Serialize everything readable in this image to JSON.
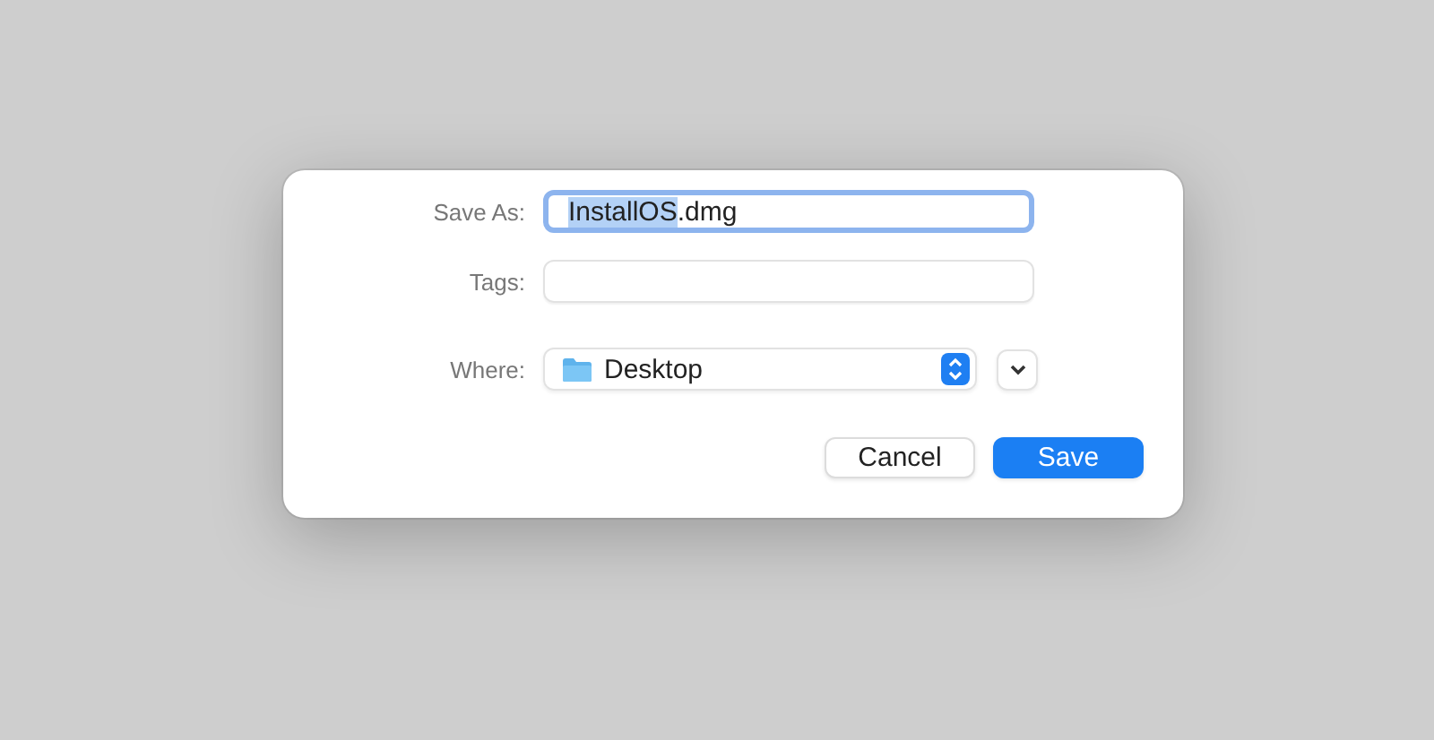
{
  "dialog": {
    "save_as": {
      "label": "Save As:",
      "focused": true,
      "value_parts": [
        {
          "text": "InstallOS",
          "selected": true
        },
        {
          "text": ".dmg",
          "selected": false
        }
      ]
    },
    "tags": {
      "label": "Tags:"
    },
    "where": {
      "label": "Where:",
      "value": "Desktop",
      "expanded": false
    },
    "buttons": [
      {
        "label": "Cancel",
        "kind": "secondary"
      },
      {
        "label": "Save",
        "kind": "primary"
      }
    ]
  }
}
